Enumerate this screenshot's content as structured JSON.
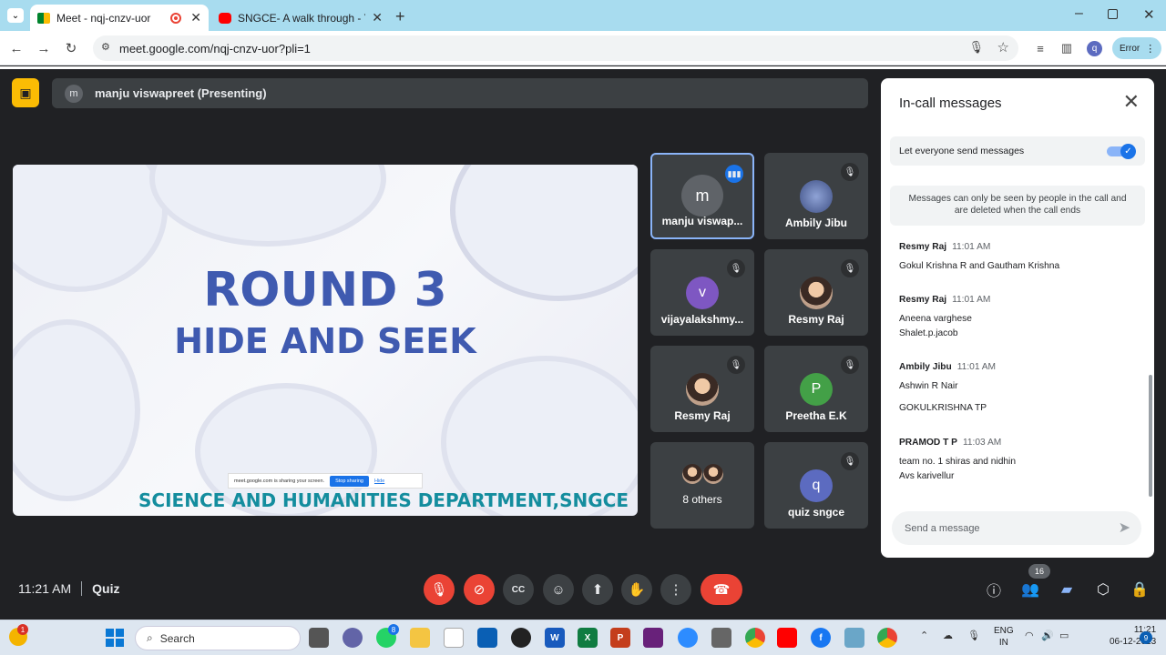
{
  "browser": {
    "tabs": [
      {
        "title": "Meet - nqj-cnzv-uor",
        "active": true
      },
      {
        "title": "SNGCE- A walk through - YouTu",
        "active": false
      }
    ],
    "url": "meet.google.com/nqj-cnzv-uor?pli=1",
    "profile_initial": "q",
    "error_label": "Error"
  },
  "presenting": {
    "avatar_initial": "m",
    "label": "manju viswapreet (Presenting)"
  },
  "slide": {
    "title": "ROUND 3",
    "subtitle": "HIDE AND SEEK",
    "department": "SCIENCE AND HUMANITIES DEPARTMENT,SNGCE",
    "share_notice": "meet.google.com is sharing your screen.",
    "stop_sharing": "Stop sharing",
    "hide": "Hide"
  },
  "participants": [
    {
      "name": "manju viswap...",
      "initial": "m",
      "avatar_color": "#5f6368",
      "speaking": true
    },
    {
      "name": "Ambily Jibu",
      "initial": "",
      "avatar_color": "#4a5a8a",
      "muted": true
    },
    {
      "name": "vijayalakshmy...",
      "initial": "v",
      "avatar_color": "#7e57c2",
      "muted": true
    },
    {
      "name": "Resmy Raj",
      "initial": "",
      "avatar_color": "#9c6b4f",
      "muted": true
    },
    {
      "name": "Resmy Raj",
      "initial": "",
      "avatar_color": "#9c6b4f",
      "muted": true
    },
    {
      "name": "Preetha E.K",
      "initial": "P",
      "avatar_color": "#43a047",
      "muted": true
    },
    {
      "name": "8 others",
      "initial": "",
      "avatar_color": "#9c6b4f"
    },
    {
      "name": "quiz sngce",
      "initial": "q",
      "avatar_color": "#5c6bc0",
      "muted": true
    }
  ],
  "chat": {
    "title": "In-call messages",
    "allow_label": "Let everyone send messages",
    "allow_enabled": true,
    "notice": "Messages can only be seen by people in the call and are deleted when the call ends",
    "messages": [
      {
        "sender": "Resmy Raj",
        "time": "11:01 AM",
        "lines": [
          "Gokul Krishna R and Gautham Krishna"
        ]
      },
      {
        "sender": "Resmy Raj",
        "time": "11:01 AM",
        "lines": [
          "Aneena varghese",
          "Shalet.p.jacob"
        ]
      },
      {
        "sender": "Ambily Jibu",
        "time": "11:01 AM",
        "lines": [
          "Ashwin R Nair",
          "GOKULKRISHNA TP"
        ]
      },
      {
        "sender": "PRAMOD T P",
        "time": "11:03 AM",
        "lines": [
          "team no. 1 shiras and nidhin",
          "Avs karivellur"
        ]
      }
    ],
    "input_placeholder": "Send a message"
  },
  "bottom": {
    "time": "11:21 AM",
    "meeting_name": "Quiz",
    "people_count": "16"
  },
  "taskbar": {
    "search_placeholder": "Search",
    "lang": "ENG",
    "region": "IN",
    "time": "11:21",
    "date": "06-12-2023",
    "notification_count": "9",
    "weather_badge": "1",
    "whatsapp_badge": "8"
  },
  "colors": {
    "meet_bg": "#202124",
    "tile_bg": "#3c4043",
    "end_call": "#ea4335",
    "accent": "#1a73e8",
    "slide_title": "#3f5ab0",
    "slide_dept": "#148d9e",
    "presenting_icon": "#fbbc04"
  }
}
